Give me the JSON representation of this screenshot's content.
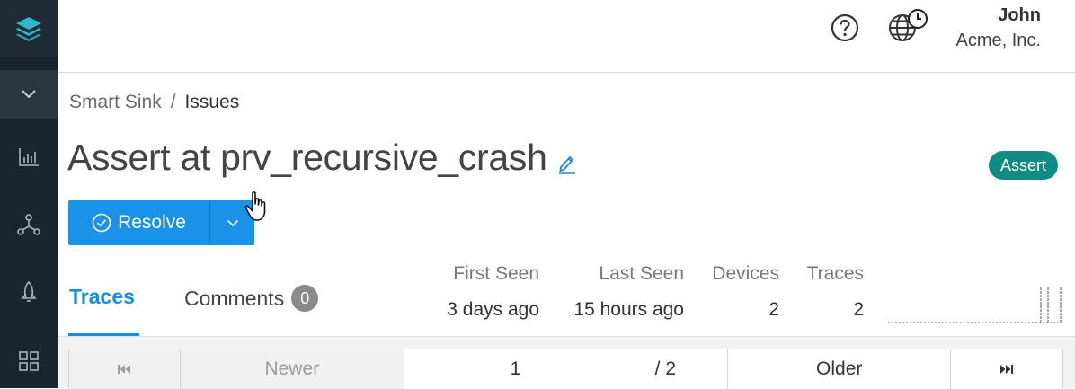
{
  "sidebar": {
    "logo": "layers-logo-icon",
    "items": [
      {
        "icon": "chevron-down-icon"
      },
      {
        "icon": "bar-chart-icon"
      },
      {
        "icon": "network-nodes-icon"
      },
      {
        "icon": "rocket-icon"
      },
      {
        "icon": "grid-icon"
      }
    ]
  },
  "header": {
    "help_icon": "help-circle-icon",
    "globe_icon": "globe-clock-icon",
    "user_name": "John",
    "org_name": "Acme, Inc."
  },
  "breadcrumb": {
    "parent": "Smart Sink",
    "separator": "/",
    "current": "Issues"
  },
  "issue": {
    "title": "Assert at prv_recursive_crash",
    "badge": "Assert",
    "badge_color": "#108c84"
  },
  "actions": {
    "resolve_label": "Resolve",
    "accent": "#1a92e8"
  },
  "tabs": [
    {
      "label": "Traces",
      "active": true
    },
    {
      "label": "Comments",
      "count": "0",
      "active": false
    }
  ],
  "stats": {
    "headers": [
      "First Seen",
      "Last Seen",
      "Devices",
      "Traces"
    ],
    "values": [
      "3 days ago",
      "15 hours ago",
      "2",
      "2"
    ]
  },
  "pager": {
    "first_icon": "skip-first-icon",
    "newer_label": "Newer",
    "current_page": "1",
    "total_pages": "/ 2",
    "older_label": "Older",
    "last_icon": "skip-last-icon"
  }
}
